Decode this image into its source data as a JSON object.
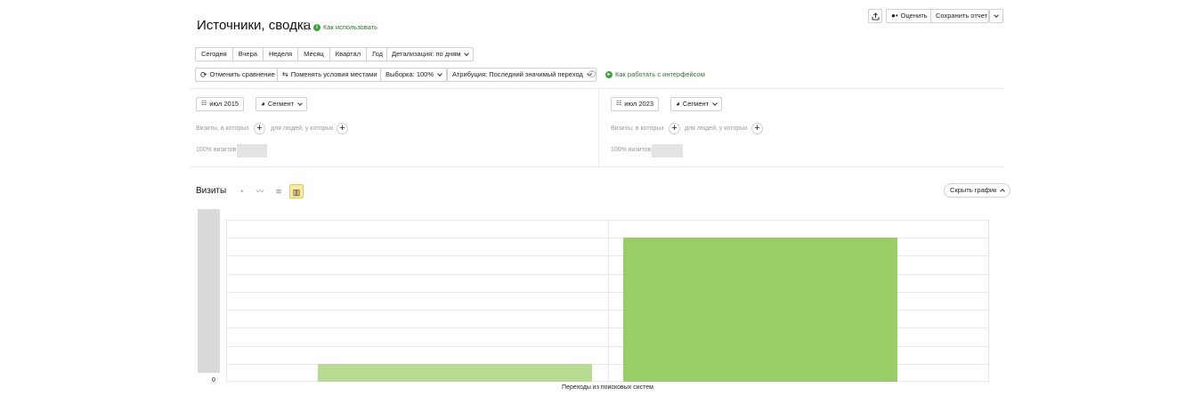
{
  "header": {
    "title": "Источники, сводка",
    "how_to_use": "Как использовать",
    "rate_label": "Оценить",
    "save_report_label": "Сохранить отчет"
  },
  "periods": [
    "Сегодня",
    "Вчера",
    "Неделя",
    "Месяц",
    "Квартал",
    "Год"
  ],
  "detail_label": "Детализация: по дням",
  "toolbar": {
    "cancel_compare": "Отменить сравнение",
    "swap_conditions": "Поменять условия местами",
    "sample": "Выборка: 100%",
    "attribution": "Атрибуция: Последний значимый переход",
    "interface_help": "Как работать с интерфейсом"
  },
  "segments": [
    {
      "period": "июл 2015",
      "segment_label": "Сегмент",
      "visits_where": "Визиты, в которых",
      "people_where": "для людей, у которых",
      "share": "100% визитов"
    },
    {
      "period": "июл 2023",
      "segment_label": "Сегмент",
      "visits_where": "Визиты, в которых",
      "people_where": "для людей, у которых",
      "share": "100% визитов"
    }
  ],
  "chart_section": {
    "title": "Визиты",
    "hide_chart": "Скрыть график",
    "icons": [
      "pie-chart-icon",
      "line-chart-icon",
      "area-chart-icon",
      "bar-chart-icon"
    ]
  },
  "chart_data": {
    "type": "bar",
    "categories": [
      "Переходы из поисковых систем"
    ],
    "series": [
      {
        "values": [
          1
        ],
        "color": "#b7dc91"
      },
      {
        "values": [
          8
        ],
        "color": "#98cd67"
      }
    ],
    "ylim": [
      0,
      9
    ],
    "y_tick_labels": [
      "0"
    ],
    "grid": true
  }
}
